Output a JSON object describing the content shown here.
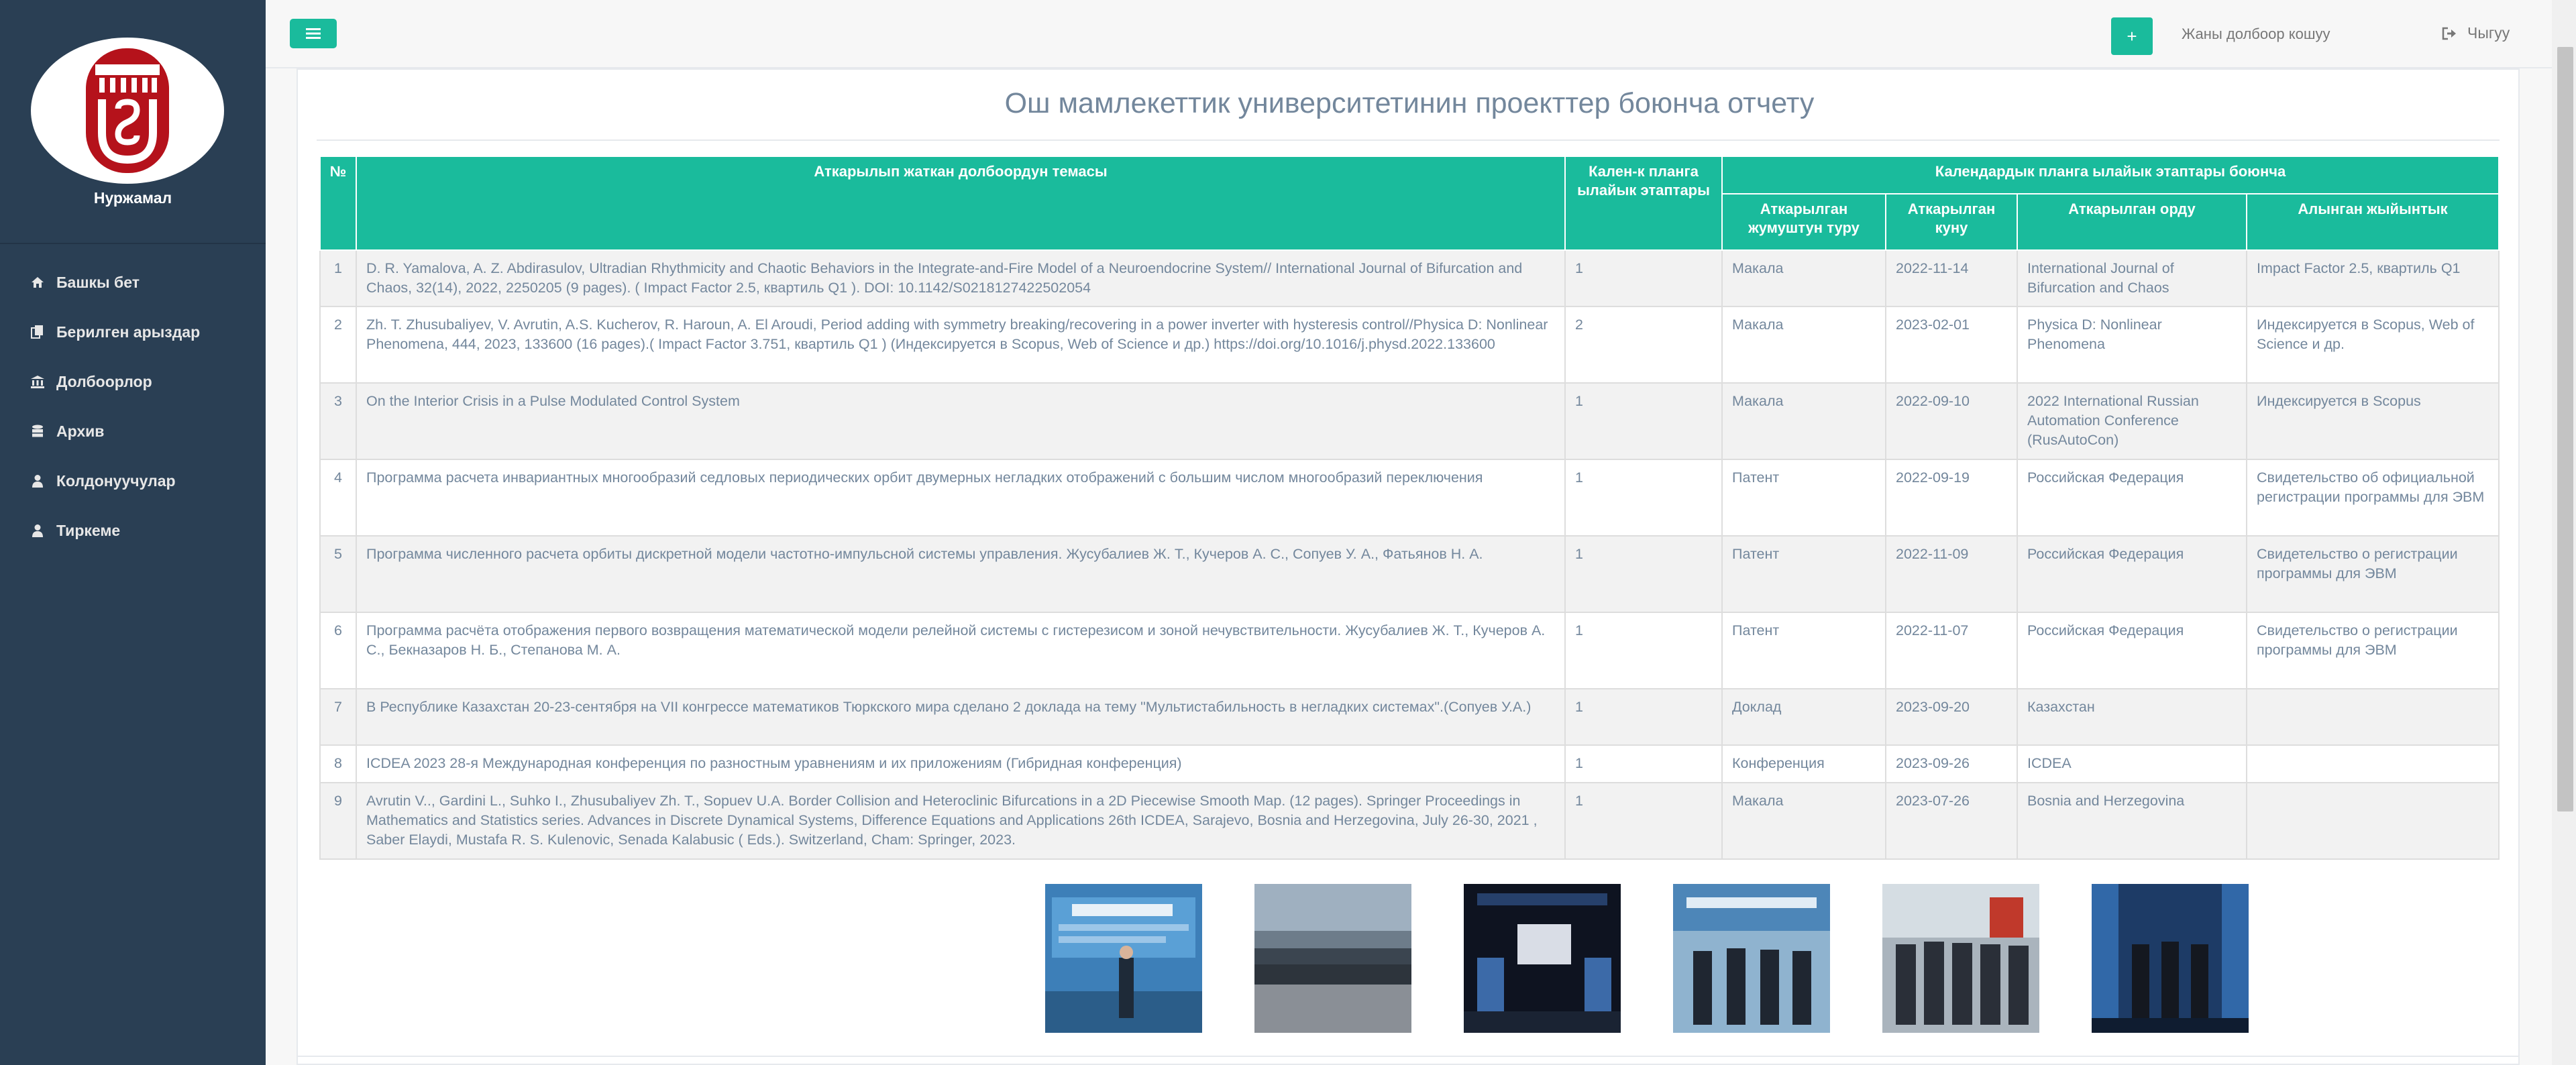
{
  "sidebar": {
    "user_name": "Нуржамал",
    "items": [
      {
        "label": "Башкы бет",
        "icon": "home-icon"
      },
      {
        "label": "Берилген арыздар",
        "icon": "files-icon"
      },
      {
        "label": "Долбоорлор",
        "icon": "bank-icon"
      },
      {
        "label": "Архив",
        "icon": "database-icon"
      },
      {
        "label": "Колдонуучулар",
        "icon": "user-icon"
      },
      {
        "label": "Тиркеме",
        "icon": "user-icon"
      }
    ]
  },
  "topbar": {
    "plus_label": "+",
    "new_project_label": "Жаны долбоор кошуу",
    "logout_label": "Чыгуу"
  },
  "page": {
    "title": "Ош мамлекеттик университетинин проекттер боюнча отчету"
  },
  "table": {
    "headers": {
      "num": "№",
      "topic": "Аткарылып жаткан долбоордун темасы",
      "stage": "Кален-к планга ылайык этаптары",
      "group": "Календардык планга ылайык этаптары боюнча",
      "work_type": "Аткарылган жумуштун туру",
      "date": "Аткарылган куну",
      "place": "Аткарылган орду",
      "result": "Алынган жыйынтык"
    },
    "rows": [
      {
        "num": "1",
        "topic": "D. R. Yamalova, A. Z. Abdirasulov, Ultradian Rhythmicity and Chaotic Behaviors in the Integrate-and-Fire Model of a Neuroendocrine System// International Journal of Bifurcation and Chaos, 32(14), 2022, 2250205 (9 pages). ( Impact Factor 2.5, квартиль Q1 ). DOI: 10.1142/S0218127422502054",
        "stage": "1",
        "work_type": "Макала",
        "date": "2022-11-14",
        "place": "International Journal of Bifurcation and Chaos",
        "result": "Impact Factor 2.5, квартиль Q1"
      },
      {
        "num": "2",
        "topic": "Zh. T. Zhusubaliyev, V. Avrutin, A.S. Kucherov, R. Haroun, A. El Aroudi, Period adding with symmetry breaking/recovering in a power inverter with hysteresis control//Physica D: Nonlinear Phenomena, 444, 2023, 133600 (16 pages).( Impact Factor 3.751, квартиль Q1 ) (Индексируется в Scopus, Web of Science и др.) https://doi.org/10.1016/j.physd.2022.133600",
        "stage": "2",
        "work_type": "Макала",
        "date": "2023-02-01",
        "place": "Physica D: Nonlinear Phenomena",
        "result": "Индексируется в Scopus, Web of Science и др."
      },
      {
        "num": "3",
        "topic": "On the Interior Crisis in a Pulse Modulated Control System",
        "stage": "1",
        "work_type": "Макала",
        "date": "2022-09-10",
        "place": "2022 International Russian Automation Conference (RusAutoCon)",
        "result": "Индексируется в Scopus"
      },
      {
        "num": "4",
        "topic": "Программа расчета инвариантных многообразий седловых периодических орбит двумерных негладких отображений с большим числом многообразий переключения",
        "stage": "1",
        "work_type": "Патент",
        "date": "2022-09-19",
        "place": "Российская Федерация",
        "result": "Свидетельство об официальной регистрации программы для ЭВМ"
      },
      {
        "num": "5",
        "topic": "Программа численного расчета орбиты дискретной модели частотно-импульсной системы управления. Жусубалиев Ж. Т., Кучеров А. С., Сопуев У. А., Фатьянов Н. А.",
        "stage": "1",
        "work_type": "Патент",
        "date": "2022-11-09",
        "place": "Российская Федерация",
        "result": "Свидетельство о регистрации программы для ЭВМ"
      },
      {
        "num": "6",
        "topic": "Программа расчёта отображения первого возвращения математической модели релейной системы с гистерезисом и зоной нечувствительности. Жусубалиев Ж. Т., Кучеров А. С., Бекназаров Н. Б., Степанова М. А.",
        "stage": "1",
        "work_type": "Патент",
        "date": "2022-11-07",
        "place": "Российская Федерация",
        "result": "Свидетельство о регистрации программы для ЭВМ"
      },
      {
        "num": "7",
        "topic": "В Республике Казахстан 20-23-сентября на VII конгрессе математиков Тюркского мира сделано 2 доклада на тему \"Мультистабильность в негладких системах\".(Сопуев У.А.)",
        "stage": "1",
        "work_type": "Доклад",
        "date": "2023-09-20",
        "place": "Казахстан",
        "result": ""
      },
      {
        "num": "8",
        "topic": "ICDEA 2023 28-я Международная конференция по разностным уравнениям и их приложениям (Гибридная конференция)",
        "stage": "1",
        "work_type": "Конференция",
        "date": "2023-09-26",
        "place": "ICDEA",
        "result": ""
      },
      {
        "num": "9",
        "topic": "Avrutin V.., Gardini L., Suhko I., Zhusubaliyev Zh. T., Sopuev U.A. Border Collision and Heteroclinic Bifurcations in a 2D Piecewise Smooth Map. (12 pages). Springer Proceedings in Mathematics and Statistics series. Advances in Discrete Dynamical Systems, Difference Equations and Applications 26th ICDEA, Sarajevo, Bosnia and Herzegovina, July 26-30, 2021 , Saber Elaydi, Mustafa R. S. Kulenovic, Senada Kalabusic ( Eds.). Switzerland, Cham: Springer, 2023.",
        "stage": "1",
        "work_type": "Макала",
        "date": "2023-07-26",
        "place": "Bosnia and Herzegovina",
        "result": ""
      }
    ]
  },
  "gallery": [
    {
      "name": "conference-photo-1"
    },
    {
      "name": "conference-photo-2"
    },
    {
      "name": "conference-photo-3"
    },
    {
      "name": "conference-photo-4"
    },
    {
      "name": "conference-photo-5"
    },
    {
      "name": "conference-photo-6"
    }
  ],
  "colors": {
    "accent": "#1abb9c",
    "sidebar": "#2a3f54",
    "logo_red": "#b5121b"
  }
}
